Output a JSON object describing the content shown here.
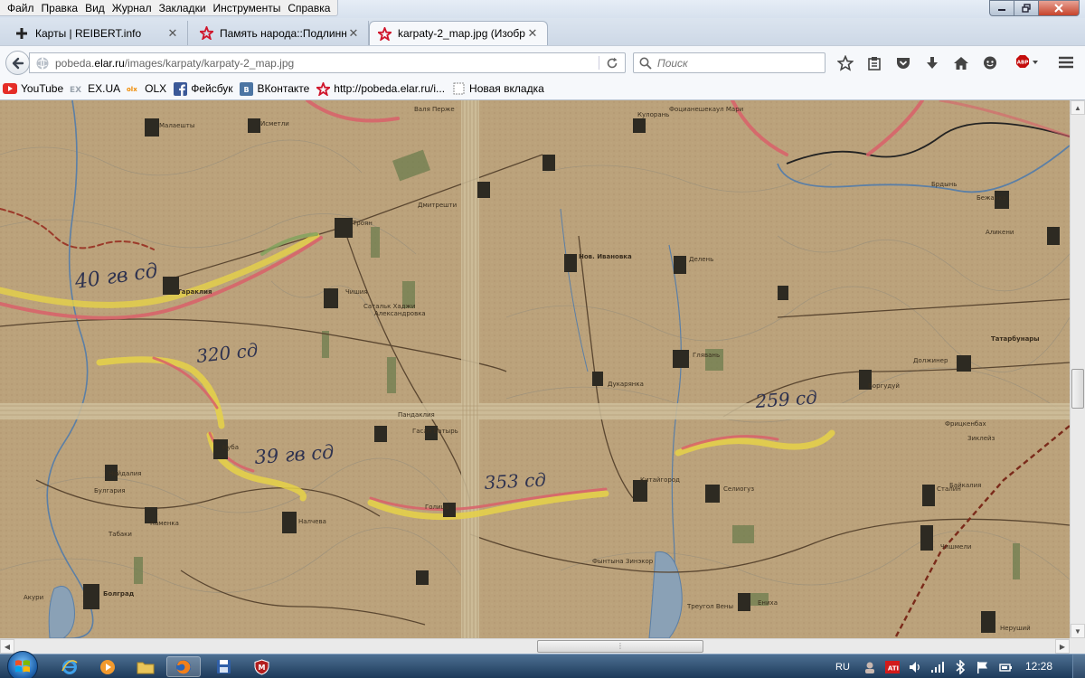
{
  "menu": [
    "Файл",
    "Правка",
    "Вид",
    "Журнал",
    "Закладки",
    "Инструменты",
    "Справка"
  ],
  "tabs": [
    {
      "label": "Карты | REIBERT.info",
      "icon": "reibert-favicon",
      "active": false
    },
    {
      "label": "Память народа::Подлинн...",
      "icon": "red-star-icon",
      "active": false
    },
    {
      "label": "karpaty-2_map.jpg (Изобр...",
      "icon": "red-star-icon",
      "active": true
    }
  ],
  "nav": {
    "url_prefix": "pobeda.",
    "url_host": "elar.ru",
    "url_path": "/images/karpaty/karpaty-2_map.jpg",
    "search_placeholder": "Поиск"
  },
  "bookmarks": [
    {
      "label": "YouTube",
      "icon": "youtube-icon"
    },
    {
      "label": "EX.UA",
      "icon": "exua-icon"
    },
    {
      "label": "OLX",
      "icon": "olx-icon"
    },
    {
      "label": "Фейсбук",
      "icon": "facebook-icon"
    },
    {
      "label": "ВКонтакте",
      "icon": "vk-icon"
    },
    {
      "label": "http://pobeda.elar.ru/i...",
      "icon": "red-star-icon"
    },
    {
      "label": "Новая вкладка",
      "icon": "blank-page-icon"
    }
  ],
  "map": {
    "handwritten": [
      "40 гв сд",
      "320 сд",
      "39 гв сд",
      "353 сд",
      "259 сд"
    ],
    "places": [
      "Малаешты",
      "Исметли",
      "Валя Перже",
      "Кулорань",
      "Фоцианешекаул Мари",
      "Брдынь",
      "Дмитрешти",
      "Троян",
      "Бежанка",
      "Нов. Ивановка",
      "Делень",
      "Аликени",
      "Тараклия",
      "Чишия",
      "Сатальк Хаджи",
      "Александровка",
      "Глявань",
      "Должинер",
      "Татарбунары",
      "Дукарянка",
      "Боргудуй",
      "Пандаклия",
      "Гасан Батырь",
      "Нуба",
      "Найдалия",
      "Булгария",
      "Табаки",
      "Каменка",
      "Голица",
      "Налчева",
      "Китайгород",
      "Селиогуз",
      "Сталин",
      "Байкалия",
      "Чишмели",
      "Фынтына Зинэкор",
      "Треугол Вены",
      "Болград",
      "Акури",
      "Ениха",
      "Неруший",
      "Зиклейз",
      "Фрицкенбах"
    ]
  },
  "taskbar": {
    "lang": "RU",
    "time": "12:28"
  }
}
